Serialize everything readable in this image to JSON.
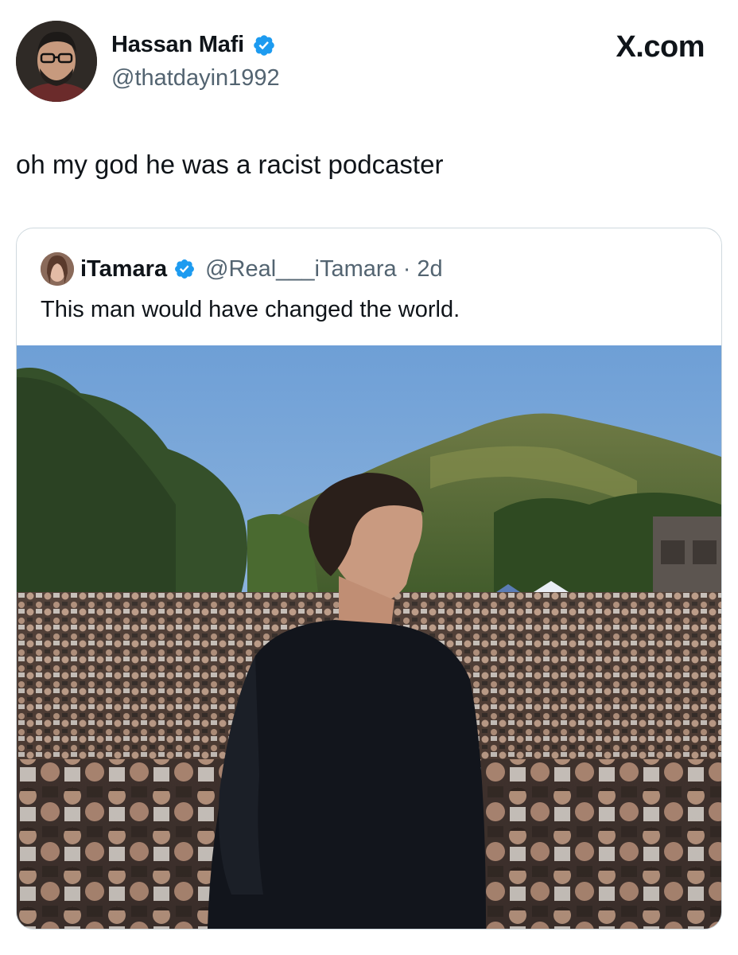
{
  "post": {
    "author_name": "Hassan Mafi",
    "author_handle": "@thatdayin1992",
    "site_label": "X.com",
    "text": "oh my god he was a racist podcaster"
  },
  "quoted_post": {
    "author_name": "iTamara",
    "author_handle": "@Real___iTamara",
    "separator": "·",
    "time": "2d",
    "text": "This man would have changed the world."
  },
  "colors": {
    "verified_blue": "#1d9bf0",
    "secondary_text": "#536471",
    "border": "#cfd9de"
  },
  "icons": {
    "verified": "verified-badge-icon",
    "logo": "x-logo"
  }
}
